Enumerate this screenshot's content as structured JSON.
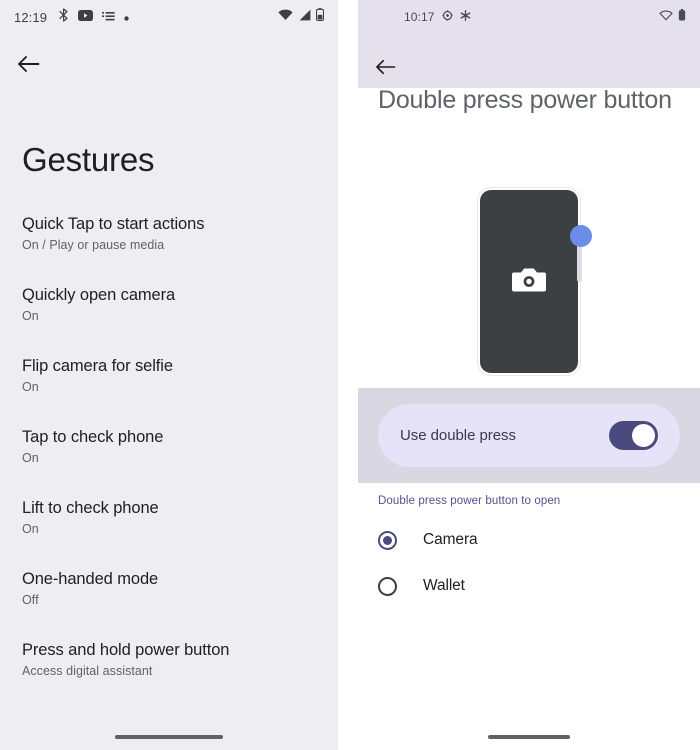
{
  "left_screen": {
    "status_bar": {
      "time": "12:19",
      "left_icons": [
        "bluetooth-icon",
        "youtube-icon",
        "list-icon",
        "dot-icon"
      ],
      "right_icons": [
        "wifi-icon",
        "signal-icon",
        "battery-icon"
      ]
    },
    "back_label": "back-arrow",
    "page_title": "Gestures",
    "items": [
      {
        "title": "Quick Tap to start actions",
        "subtitle": "On / Play or pause media"
      },
      {
        "title": "Quickly open camera",
        "subtitle": "On"
      },
      {
        "title": "Flip camera for selfie",
        "subtitle": "On"
      },
      {
        "title": "Tap to check phone",
        "subtitle": "On"
      },
      {
        "title": "Lift to check phone",
        "subtitle": "On"
      },
      {
        "title": "One-handed mode",
        "subtitle": "Off"
      },
      {
        "title": "Press and hold power button",
        "subtitle": "Access digital assistant"
      }
    ]
  },
  "right_screen": {
    "status_bar": {
      "time": "10:17",
      "left_icons": [
        "gear-icon",
        "snowflake-icon"
      ],
      "right_icons": [
        "wifi-off-icon",
        "battery-icon"
      ]
    },
    "back_label": "back-arrow",
    "page_title": "Double press power button",
    "illustration": {
      "device_icon": "camera-icon",
      "side_button": "power-button",
      "press_indicator": "press-dot"
    },
    "toggle": {
      "label": "Use double press",
      "state": "on"
    },
    "section_label": "Double press power button to open",
    "options": [
      {
        "label": "Camera",
        "selected": true
      },
      {
        "label": "Wallet",
        "selected": false
      }
    ]
  },
  "colors": {
    "left_background": "#EEEDF2",
    "right_background": "#FFFFFF",
    "top_band": "#E4E1EC",
    "toggle_band": "#D9D7E2",
    "toggle_card": "#E6E2F7",
    "accent_purple": "#4A4A7E",
    "section_label": "#5A4E8C",
    "phone_body": "#3C4043",
    "press_dot": "#6C8CE8"
  }
}
